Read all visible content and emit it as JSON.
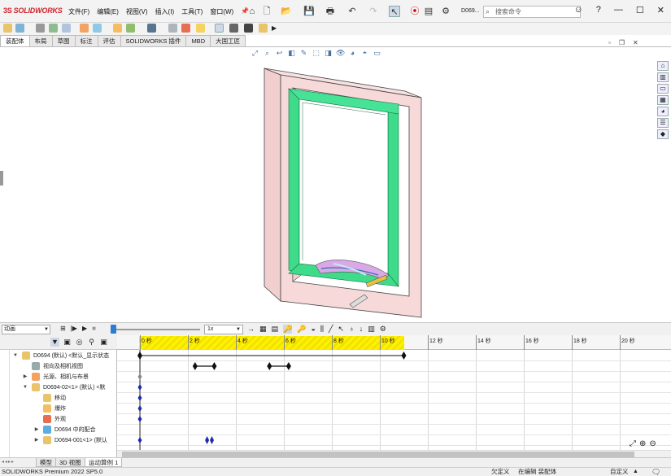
{
  "app": {
    "logo": "SOLIDWORKS",
    "document_short": "D069..."
  },
  "menu": [
    "文件(F)",
    "编辑(E)",
    "视图(V)",
    "插入(I)",
    "工具(T)",
    "窗口(W)"
  ],
  "search": {
    "placeholder": "搜索命令"
  },
  "command_tabs": [
    "装配体",
    "布局",
    "草图",
    "标注",
    "评估",
    "SOLIDWORKS 插件",
    "MBD",
    "大国工匠"
  ],
  "command_tabs_active": "装配体",
  "motion": {
    "study_type": "动画",
    "playback_speed": "1x",
    "timebar_position_s": 0,
    "ruler_labels": [
      "0 秒",
      "2 秒",
      "4 秒",
      "6 秒",
      "8 秒",
      "10 秒",
      "12 秒",
      "14 秒",
      "16 秒",
      "18 秒",
      "20 秒"
    ],
    "yellow_region_end_s": 11,
    "key_diamond_color": "#1e2ea8"
  },
  "tree": [
    {
      "label": "D0694 (默认) <默认_显示状态",
      "icon": "assembly",
      "expander": "▼"
    },
    {
      "label": "视向及相机视图",
      "icon": "camera",
      "expander": ""
    },
    {
      "label": "光源、相机与布景",
      "icon": "lights",
      "expander": "▶"
    },
    {
      "label": "D0694-02<1> (默认) <默",
      "icon": "assembly",
      "expander": "▼"
    },
    {
      "label": "移动",
      "icon": "move",
      "expander": ""
    },
    {
      "label": "爆炸",
      "icon": "explode",
      "expander": ""
    },
    {
      "label": "外观",
      "icon": "appearance",
      "expander": ""
    },
    {
      "label": "D0694 中的配合",
      "icon": "mates",
      "expander": "▶"
    },
    {
      "label": "D0694-001<1> (默认",
      "icon": "part",
      "expander": "▶"
    }
  ],
  "bottom_tabs": [
    "模型",
    "3D 视图",
    "运动算例 1"
  ],
  "bottom_tabs_active": "运动算例 1",
  "status": {
    "product": "SOLIDWORKS Premium 2022 SP5.0",
    "constraint": "欠定义",
    "editing": "在编辑 装配体",
    "units": "自定义"
  },
  "colors": {
    "frame": "#f7d9d9",
    "sash": "#3ddb8a",
    "accent": "#2c7cd0",
    "brand": "#d2232a"
  }
}
